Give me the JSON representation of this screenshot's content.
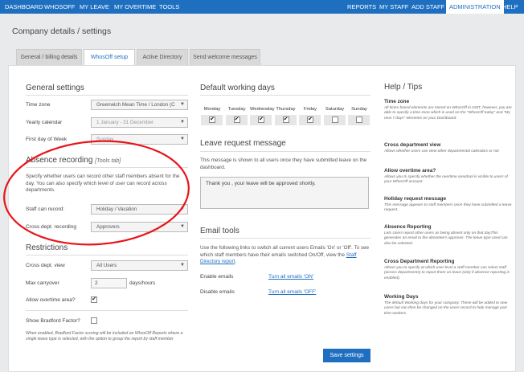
{
  "nav": {
    "left": [
      "DASHBOARD",
      "WHOSOFF",
      "MY LEAVE",
      "MY OVERTIME",
      "TOOLS"
    ],
    "right": [
      "REPORTS",
      "MY STAFF",
      "ADD STAFF",
      "ADMINISTRATION",
      "HELP"
    ]
  },
  "page_title": "Company details / settings",
  "tabs": [
    "General / billing details",
    "WhosOff setup",
    "Active Directory",
    "Send welcome messages"
  ],
  "general": {
    "heading": "General settings",
    "timezone_label": "Time zone",
    "timezone_value": "Greenwich Mean Time / London (C",
    "calendar_label": "Yearly calendar",
    "calendar_value": "1 January - 31 December",
    "firstday_label": "First day of Week",
    "firstday_value": "Sunday"
  },
  "absence": {
    "heading": "Absence recording",
    "heading_note": "[Tools tab]",
    "description": "Specify whether users can record other staff members absent for the day. You can also specify which level of user can record across departments.",
    "staff_label": "Staff can record:",
    "staff_value": "Holiday / Vacation",
    "cross_label": "Cross dept. recording",
    "cross_value": "Approvers"
  },
  "restrictions": {
    "heading": "Restrictions",
    "crossview_label": "Cross dept. view",
    "crossview_value": "All Users",
    "carryover_label": "Max carryover",
    "carryover_value": "2",
    "carryover_unit": "days/hours",
    "overtime_label": "Allow overtime area?",
    "bradford_label": "Show Bradford Factor?",
    "bradford_note": "When enabled, Bradford Factor scoring will be included on WhosOff Reports where a single leave type is selected, with the option to group the report by staff member"
  },
  "working_days": {
    "heading": "Default working days",
    "days": [
      "Monday",
      "Tuesday",
      "Wednesday",
      "Thursday",
      "Friday",
      "Saturday",
      "Sunday"
    ],
    "checked": [
      true,
      true,
      true,
      true,
      true,
      false,
      false
    ]
  },
  "leave_message": {
    "heading": "Leave request message",
    "description": "This message is shown to all users once they have submitted leave on the dashboard.",
    "text": "Thank you , your leave will be approved shortly."
  },
  "email_tools": {
    "heading": "Email tools",
    "description": "Use the following links to switch all current users Emails 'On' or 'Off'. To see which staff members have their emails switched On/Off, view the",
    "directory_link": "Staff Directory report",
    "enable_label": "Enable emails",
    "enable_link": "Turn all emails 'ON'",
    "disable_label": "Disable emails",
    "disable_link": "Turn all emails 'OFF'"
  },
  "save_label": "Save settings",
  "help": {
    "heading": "Help / Tips",
    "items": [
      {
        "title": "Time zone",
        "text": "All times based elements are stored on WhosOff in GMT, however, you are able to specify a time zone which is used on the \"WhosOff today\" and \"My next 7 days\" elements on your Dashboard."
      },
      {
        "title": "Cross department view",
        "text": "Allows whether users can view other departmental calendars or not"
      },
      {
        "title": "Allow overtime area?",
        "text": "Allows you to specify whether the overtime area/tool is visible to users of your WhosOff account."
      },
      {
        "title": "Holiday request message",
        "text": "This message appears to staff members once they have submitted a leave request."
      },
      {
        "title": "Absence Reporting",
        "text": "Lets Users report other users as being absent only on that dayThis generates an email to the absentee's approver. The leave type used can also be selected."
      },
      {
        "title": "Cross Department Reporting",
        "text": "Allows you to specify at which user level a staff member can select staff (across departments) to report them on leave (only if absence reporting is enabled)."
      },
      {
        "title": "Working Days",
        "text": "The default Working days for your company. These will be added to new users but can then be changed on the users record to help manage part time workers."
      }
    ]
  },
  "colors": {
    "nav_bg": "#1f6fc1",
    "annotation": "#e8141a"
  }
}
